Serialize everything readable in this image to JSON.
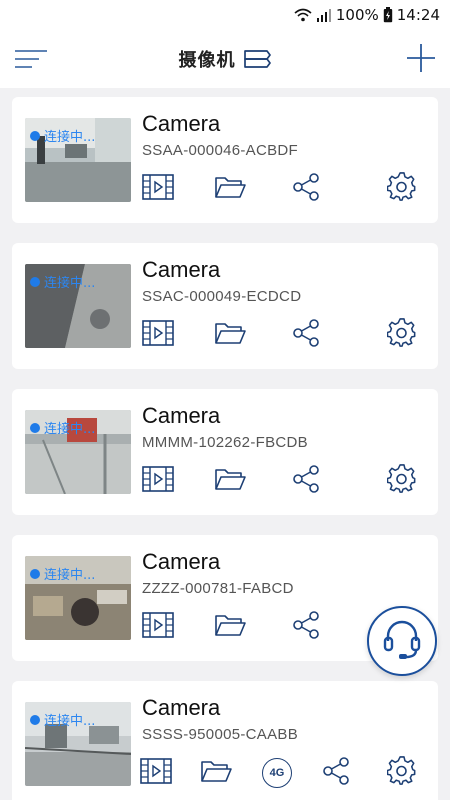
{
  "status_bar": {
    "battery": "100%",
    "time": "14:24",
    "icons": [
      "wifi-icon",
      "signal-icon",
      "battery-icon"
    ]
  },
  "header": {
    "title": "摄像机",
    "menu_icon": "menu-icon",
    "title_icon": "layers-icon",
    "add_icon": "plus-icon"
  },
  "cameras": [
    {
      "name": "Camera",
      "id": "SSAA-000046-ACBDF",
      "status": "连接中..."
    },
    {
      "name": "Camera",
      "id": "SSAC-000049-ECDCD",
      "status": "连接中..."
    },
    {
      "name": "Camera",
      "id": "MMMM-102262-FBCDB",
      "status": "连接中..."
    },
    {
      "name": "Camera",
      "id": "ZZZZ-000781-FABCD",
      "status": "连接中..."
    },
    {
      "name": "Camera",
      "id": "SSSS-950005-CAABB",
      "status": "连接中...",
      "badge": "4G"
    }
  ],
  "colors": {
    "accent": "#1d3f74",
    "status_blue": "#2c86f0",
    "background": "#f1f1f3"
  }
}
